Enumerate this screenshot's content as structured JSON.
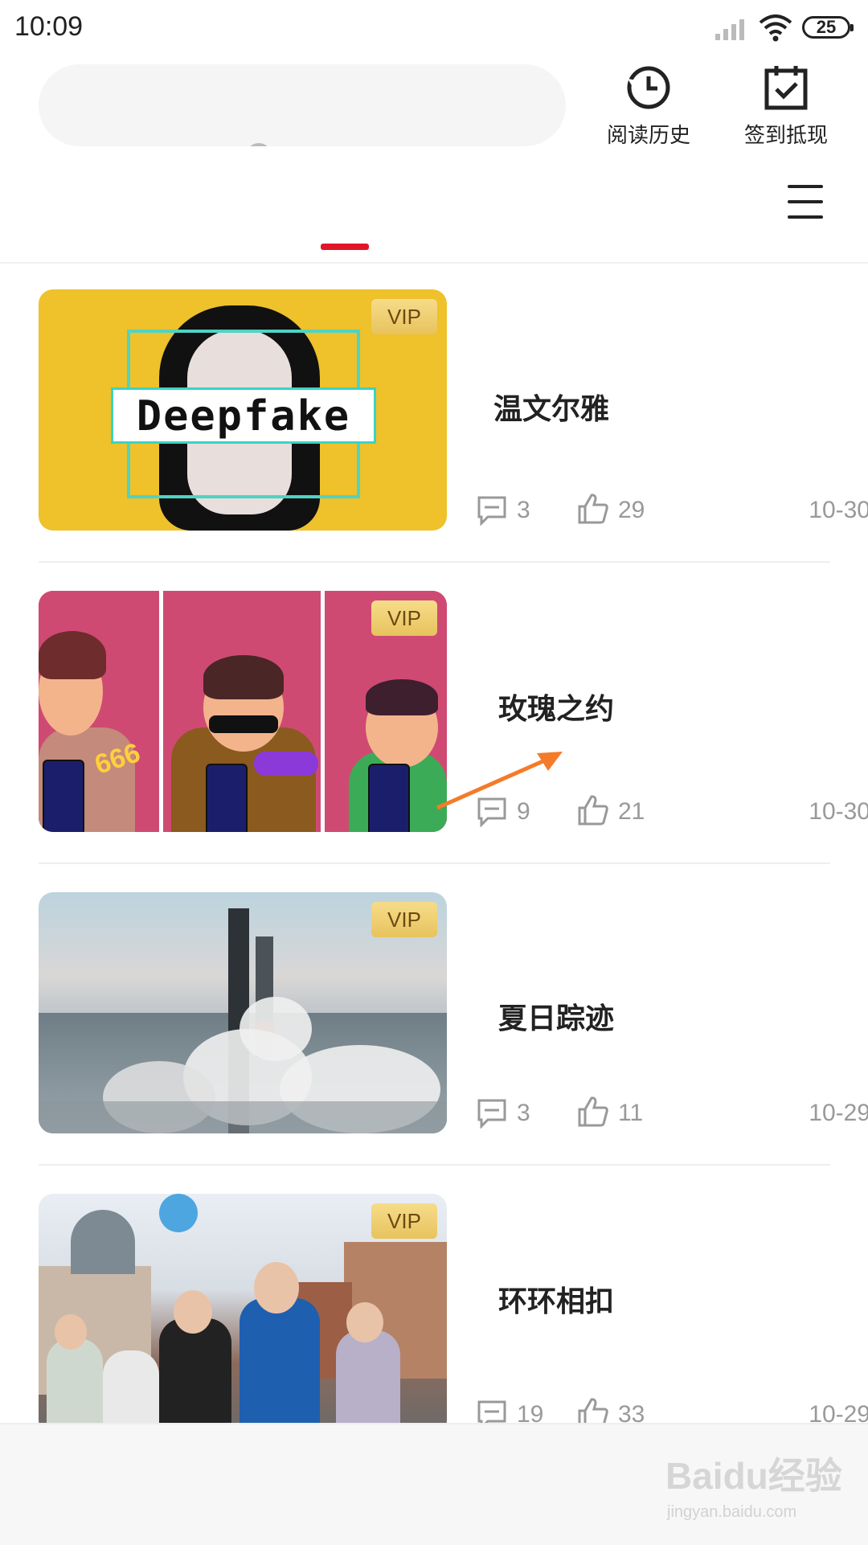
{
  "status_bar": {
    "time": "10:09",
    "battery": "25"
  },
  "header": {
    "search_placeholder": "",
    "history_label": "阅读历史",
    "checkin_label": "签到抵现"
  },
  "feed": [
    {
      "title": "温文尔雅",
      "badge": "VIP",
      "comments": "3",
      "likes": "29",
      "date": "10-30",
      "thumb_text": "Deepfake"
    },
    {
      "title": "玫瑰之约",
      "badge": "VIP",
      "comments": "9",
      "likes": "21",
      "date": "10-30",
      "thumb_text": "666"
    },
    {
      "title": "夏日踪迹",
      "badge": "VIP",
      "comments": "3",
      "likes": "11",
      "date": "10-29"
    },
    {
      "title": "环环相扣",
      "badge": "VIP",
      "comments": "19",
      "likes": "33",
      "date": "10-29"
    }
  ],
  "watermark": {
    "brand": "Baidu经验",
    "url": "jingyan.baidu.com"
  },
  "colors": {
    "accent": "#e0172a",
    "vip_gold": "#e8c35d",
    "meta_gray": "#999999"
  }
}
